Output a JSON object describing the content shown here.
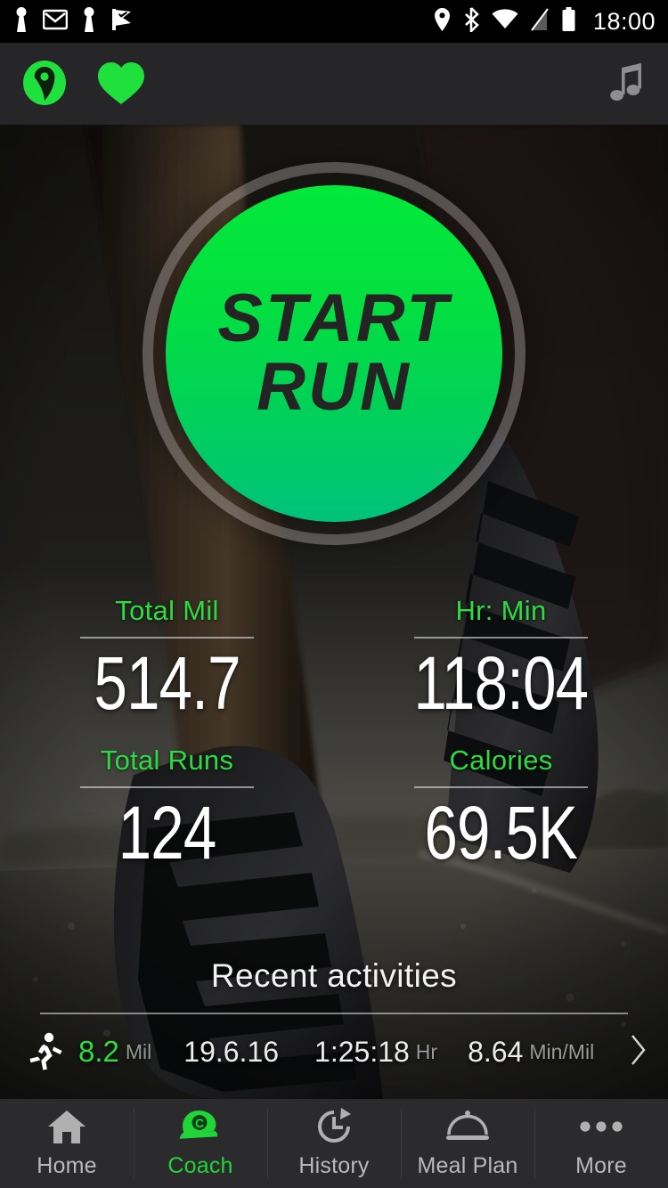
{
  "status_bar": {
    "time": "18:00",
    "notification_icons": [
      "keyhole-icon",
      "gmail-icon",
      "keyhole-icon",
      "checkmark-flag-icon"
    ],
    "system_icons": [
      "location-pin-icon",
      "bluetooth-icon",
      "wifi-icon",
      "no-signal-icon",
      "battery-icon"
    ]
  },
  "app_bar": {
    "gps_icon": "location-pin-circle-icon",
    "heart_icon": "heart-icon",
    "music_icon": "music-note-icon",
    "accent_color": "#1fe03c",
    "background_color": "#262628"
  },
  "start_button": {
    "line1": "START",
    "line2": "RUN",
    "gradient_top": "#03e83b",
    "gradient_bottom": "#00c27a",
    "text_color": "#242424",
    "ring_color": "rgba(205,200,198,0.34)"
  },
  "stats": [
    {
      "label": "Total Mil",
      "value": "514.7"
    },
    {
      "label": "Hr: Min",
      "value": "118:04"
    },
    {
      "label": "Total Runs",
      "value": "124"
    },
    {
      "label": "Calories",
      "value": "69.5K"
    }
  ],
  "recent": {
    "title": "Recent activities",
    "activities": [
      {
        "icon": "running-person-icon",
        "distance": "8.2",
        "distance_unit": "Mil",
        "date": "19.6.16",
        "duration": "1:25:18",
        "duration_unit": "Hr",
        "pace": "8.64",
        "pace_unit": "Min/Mil",
        "chevron": "chevron-right-icon"
      }
    ]
  },
  "bottom_nav": {
    "active_index": 1,
    "active_color": "#21d437",
    "inactive_color": "#b9b9b9",
    "items": [
      {
        "label": "Home",
        "icon": "home-icon"
      },
      {
        "label": "Coach",
        "icon": "cap-icon"
      },
      {
        "label": "History",
        "icon": "history-clock-icon"
      },
      {
        "label": "Meal Plan",
        "icon": "food-dome-icon"
      },
      {
        "label": "More",
        "icon": "more-dots-icon"
      }
    ]
  }
}
